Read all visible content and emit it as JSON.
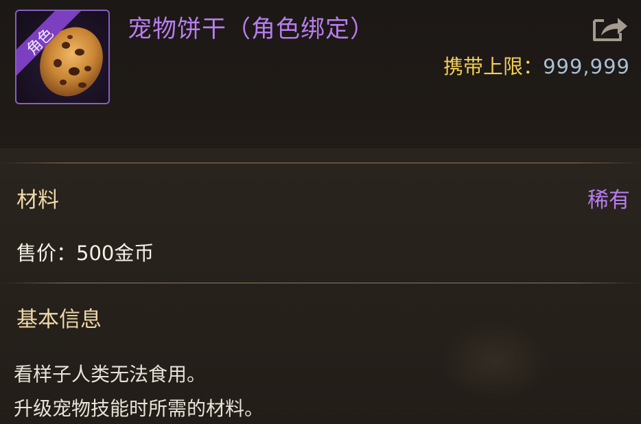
{
  "item": {
    "badge": "角色",
    "name": "宠物饼干（角色绑定）",
    "carry_label": "携带上限：",
    "carry_value": "999,999",
    "type": "材料",
    "rarity": "稀有",
    "price_label": "售价：",
    "price_value": "500金币",
    "info_heading": "基本信息",
    "description": [
      "看样子人类无法食用。",
      "升级宠物技能时所需的材料。"
    ]
  },
  "icons": {
    "item_icon": "cookie-icon",
    "share": "share-icon"
  },
  "colors": {
    "name": "#b77df0",
    "rarity": "#b77df0",
    "carry_label": "#f3cf58",
    "carry_value": "#a9bfd3",
    "section_label": "#efd9a8",
    "text": "#f4f0e6",
    "frame": "#8a5ec4"
  }
}
